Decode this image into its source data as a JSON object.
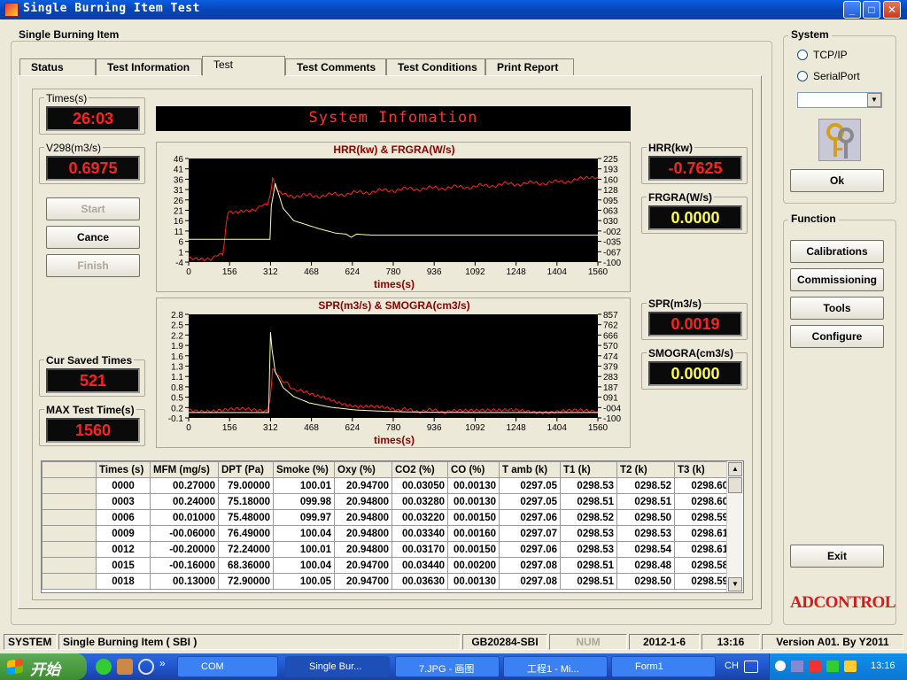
{
  "window": {
    "title": "Single Burning Item Test"
  },
  "main_group": {
    "title": "Single Burning Item"
  },
  "tabs": [
    {
      "label": "Status"
    },
    {
      "label": "Test Information"
    },
    {
      "label": "Test"
    },
    {
      "label": "Test Comments"
    },
    {
      "label": "Test Conditions"
    },
    {
      "label": "Print Report"
    }
  ],
  "times": {
    "label": "Times(s)",
    "value": "26:03"
  },
  "v298": {
    "label": "V298(m3/s)",
    "value": "0.6975"
  },
  "buttons": {
    "start": "Start",
    "cancel": "Cance",
    "finish": "Finish",
    "ok": "Ok",
    "exit": "Exit"
  },
  "cur_saved": {
    "label": "Cur Saved Times",
    "value": "521"
  },
  "max_test": {
    "label": "MAX Test Time(s)",
    "value": "1560"
  },
  "system_info": "System Infomation",
  "hrr": {
    "label": "HRR(kw)",
    "value": "-0.7625"
  },
  "frgra": {
    "label": "FRGRA(W/s)",
    "value": "0.0000"
  },
  "spr": {
    "label": "SPR(m3/s)",
    "value": "0.0019"
  },
  "smogra": {
    "label": "SMOGRA(cm3/s)",
    "value": "0.0000"
  },
  "system_group": {
    "title": "System",
    "tcpip": "TCP/IP",
    "serial": "SerialPort",
    "select_value": ""
  },
  "function_group": {
    "title": "Function",
    "calibrations": "Calibrations",
    "commissioning": "Commissioning",
    "tools": "Tools",
    "configure": "Configure"
  },
  "logo": "ADCONTROL",
  "chart_data": [
    {
      "type": "line",
      "title": "HRR(kw) & FRGRA(W/s)",
      "xlabel": "times(s)",
      "x_ticks": [
        "0",
        "156",
        "312",
        "468",
        "624",
        "780",
        "936",
        "1092",
        "1248",
        "1404",
        "1560"
      ],
      "y_left_ticks": [
        "46",
        "41",
        "36",
        "31",
        "26",
        "21",
        "16",
        "11",
        "6",
        "1",
        "-4"
      ],
      "y_right_ticks": [
        "225",
        "193",
        "160",
        "128",
        "095",
        "063",
        "030",
        "-002",
        "-035",
        "-067",
        "-100"
      ],
      "xlim": [
        0,
        1560
      ],
      "ylim_left": [
        -4,
        46
      ],
      "series": [
        {
          "color": "#ff2020",
          "axis": "left",
          "x": [
            0,
            90,
            130,
            150,
            200,
            260,
            300,
            310,
            320,
            340,
            400,
            500,
            600,
            700,
            800,
            900,
            1000,
            1100,
            1200,
            1300,
            1400,
            1500,
            1560
          ],
          "y": [
            -2,
            -2,
            0,
            20,
            21,
            22,
            24,
            28,
            37,
            30,
            28,
            28,
            29,
            30,
            31,
            31.5,
            32,
            32.5,
            33.5,
            34,
            34.5,
            36,
            37
          ]
        },
        {
          "color": "#ffffb0",
          "axis": "left",
          "x": [
            0,
            100,
            200,
            310,
            315,
            330,
            360,
            400,
            450,
            500,
            560,
            600,
            620,
            640,
            700,
            800,
            1000,
            1200,
            1560
          ],
          "y": [
            7,
            7,
            7,
            7,
            23,
            34,
            22,
            16,
            14,
            12,
            10,
            9.5,
            8,
            9.5,
            9,
            9,
            9,
            9,
            9
          ]
        }
      ]
    },
    {
      "type": "line",
      "title": "SPR(m3/s) & SMOGRA(cm3/s)",
      "xlabel": "times(s)",
      "x_ticks": [
        "0",
        "156",
        "312",
        "468",
        "624",
        "780",
        "936",
        "1092",
        "1248",
        "1404",
        "1560"
      ],
      "y_left_ticks": [
        "2.8",
        "2.5",
        "2.2",
        "1.9",
        "1.6",
        "1.3",
        "1.1",
        "0.8",
        "0.5",
        "0.2",
        "-0.1"
      ],
      "y_right_ticks": [
        "857",
        "762",
        "666",
        "570",
        "474",
        "379",
        "283",
        "187",
        "091",
        "-004",
        "-100"
      ],
      "xlim": [
        0,
        1560
      ],
      "ylim_left": [
        -0.1,
        2.8
      ],
      "series": [
        {
          "color": "#ff2020",
          "axis": "left",
          "x": [
            0,
            300,
            310,
            320,
            340,
            380,
            420,
            480,
            560,
            640,
            720,
            800,
            900,
            1000,
            1200,
            1560
          ],
          "y": [
            0.12,
            0.12,
            0.4,
            1.3,
            1.1,
            0.8,
            0.65,
            0.5,
            0.35,
            0.25,
            0.18,
            0.12,
            0.1,
            0.09,
            0.09,
            0.08
          ]
        },
        {
          "color": "#ffffb0",
          "axis": "left",
          "x": [
            0,
            305,
            312,
            318,
            330,
            360,
            400,
            460,
            540,
            640,
            760,
            900,
            1100,
            1560
          ],
          "y": [
            0.05,
            0.05,
            2.3,
            1.8,
            1.2,
            0.75,
            0.5,
            0.32,
            0.2,
            0.12,
            0.08,
            0.06,
            0.05,
            0.05
          ]
        }
      ]
    }
  ],
  "table": {
    "headers": [
      "Times (s)",
      "MFM (mg/s)",
      "DPT (Pa)",
      "Smoke (%)",
      "Oxy (%)",
      "CO2 (%)",
      "CO (%)",
      "T amb (k)",
      "T1  (k)",
      "T2   (k)",
      "T3   (k)"
    ],
    "rows": [
      [
        "0000",
        "00.27000",
        "79.00000",
        "100.01",
        "20.94700",
        "00.03050",
        "00.00130",
        "0297.05",
        "0298.53",
        "0298.52",
        "0298.60"
      ],
      [
        "0003",
        "00.24000",
        "75.18000",
        "099.98",
        "20.94800",
        "00.03280",
        "00.00130",
        "0297.05",
        "0298.51",
        "0298.51",
        "0298.60"
      ],
      [
        "0006",
        "00.01000",
        "75.48000",
        "099.97",
        "20.94800",
        "00.03220",
        "00.00150",
        "0297.06",
        "0298.52",
        "0298.50",
        "0298.59"
      ],
      [
        "0009",
        "-00.06000",
        "76.49000",
        "100.04",
        "20.94800",
        "00.03340",
        "00.00160",
        "0297.07",
        "0298.53",
        "0298.53",
        "0298.61"
      ],
      [
        "0012",
        "-00.20000",
        "72.24000",
        "100.01",
        "20.94800",
        "00.03170",
        "00.00150",
        "0297.06",
        "0298.53",
        "0298.54",
        "0298.61"
      ],
      [
        "0015",
        "-00.16000",
        "68.36000",
        "100.04",
        "20.94700",
        "00.03440",
        "00.00200",
        "0297.08",
        "0298.51",
        "0298.48",
        "0298.58"
      ],
      [
        "0018",
        "00.13000",
        "72.90000",
        "100.05",
        "20.94700",
        "00.03630",
        "00.00130",
        "0297.08",
        "0298.51",
        "0298.50",
        "0298.59"
      ]
    ]
  },
  "statusbar": {
    "system": "SYSTEM",
    "mode": "Single Burning Item ( SBI )",
    "standard": "GB20284-SBI",
    "num": "NUM",
    "date": "2012-1-6",
    "time": "13:16",
    "version": "Version A01. By Y2011"
  },
  "taskbar": {
    "start": "开始",
    "tasks": [
      "COM",
      "Single Bur...",
      "7.JPG - 画图",
      "工程1 - Mi...",
      "Form1"
    ],
    "lang": "CH",
    "clock": "13:16"
  }
}
